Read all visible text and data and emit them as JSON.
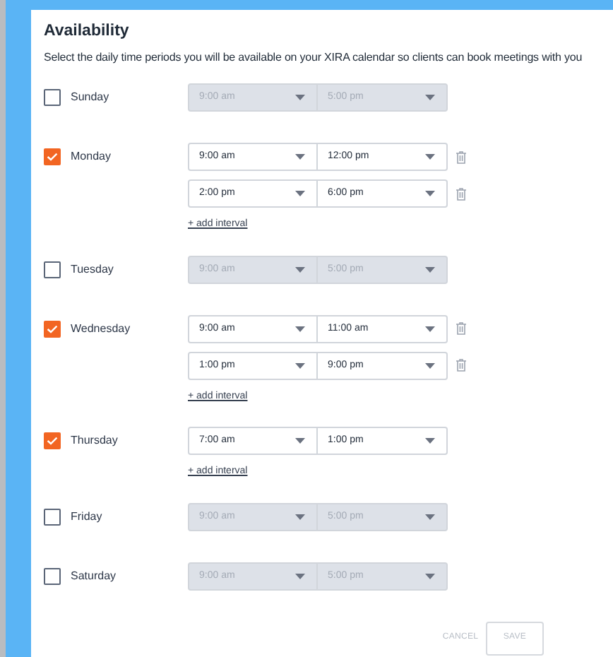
{
  "title": "Availability",
  "description": "Select the daily time periods you will be available on your XIRA calendar so clients can book meetings with you",
  "days": [
    {
      "name": "Sunday",
      "checked": false,
      "intervals": [
        {
          "start": "9:00 am",
          "end": "5:00 pm"
        }
      ]
    },
    {
      "name": "Monday",
      "checked": true,
      "intervals": [
        {
          "start": "9:00 am",
          "end": "12:00 pm"
        },
        {
          "start": "2:00 pm",
          "end": "6:00 pm"
        }
      ],
      "add_link": "+ add interval"
    },
    {
      "name": "Tuesday",
      "checked": false,
      "intervals": [
        {
          "start": "9:00 am",
          "end": "5:00 pm"
        }
      ]
    },
    {
      "name": "Wednesday",
      "checked": true,
      "intervals": [
        {
          "start": "9:00 am",
          "end": "11:00 am"
        },
        {
          "start": "1:00 pm",
          "end": "9:00 pm"
        }
      ],
      "add_link": "+ add interval"
    },
    {
      "name": "Thursday",
      "checked": true,
      "intervals": [
        {
          "start": "7:00 am",
          "end": "1:00 pm"
        }
      ],
      "add_link": "+ add interval"
    },
    {
      "name": "Friday",
      "checked": false,
      "intervals": [
        {
          "start": "9:00 am",
          "end": "5:00 pm"
        }
      ]
    },
    {
      "name": "Saturday",
      "checked": false,
      "intervals": [
        {
          "start": "9:00 am",
          "end": "5:00 pm"
        }
      ]
    }
  ],
  "buttons": {
    "cancel": "CANCEL",
    "save": "SAVE"
  }
}
